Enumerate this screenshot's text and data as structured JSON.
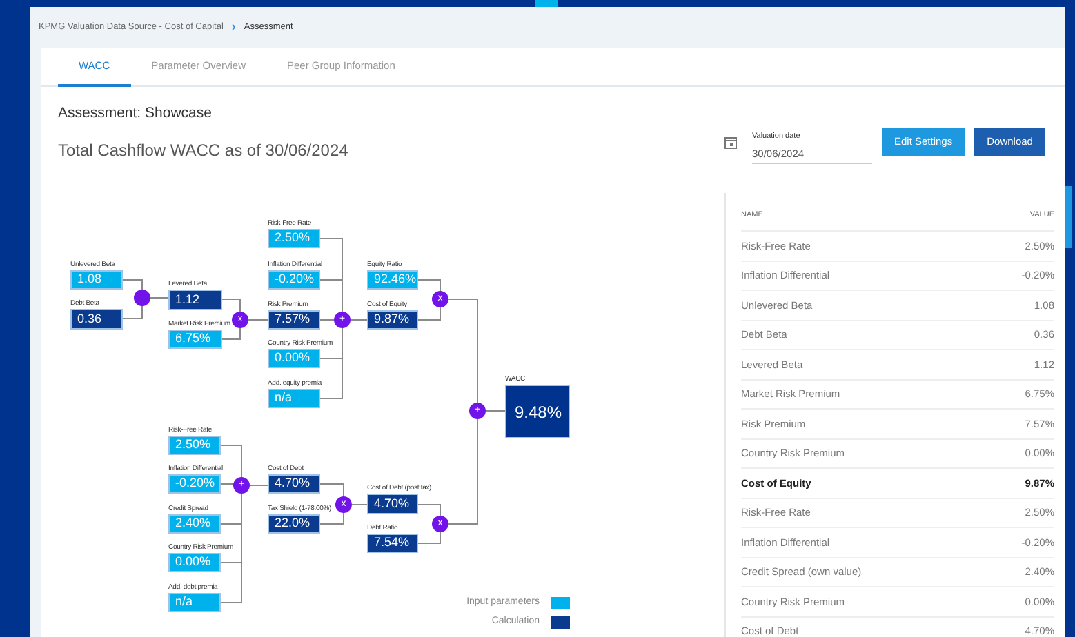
{
  "breadcrumb": {
    "items": [
      "KPMG Valuation Data Source - Cost of Capital",
      "Assessment"
    ],
    "separator": "›"
  },
  "tabs": [
    {
      "label": "WACC",
      "selected": true
    },
    {
      "label": "Parameter Overview",
      "selected": false
    },
    {
      "label": "Peer Group Information",
      "selected": false
    }
  ],
  "heading": "Assessment: Showcase",
  "subtitle": "Total Cashflow WACC as of 30/06/2024",
  "valuation_date": {
    "label": "Valuation date",
    "value": "30/06/2024"
  },
  "buttons": [
    {
      "label": "Edit Settings",
      "kind": "secondary"
    },
    {
      "label": "Download",
      "kind": "primary"
    }
  ],
  "diagram": {
    "nodes": [
      {
        "label": "Unlevered Beta",
        "value": "1.08",
        "kind": "input"
      },
      {
        "label": "Debt Beta",
        "value": "0.36",
        "kind": "calc"
      },
      {
        "label": "Levered Beta",
        "value": "1.12",
        "kind": "calc"
      },
      {
        "label": "Market Risk Premium",
        "value": "6.75%",
        "kind": "input"
      },
      {
        "label": "Risk-Free Rate",
        "value": "2.50%",
        "kind": "input"
      },
      {
        "label": "Inflation Differential",
        "value": "-0.20%",
        "kind": "input"
      },
      {
        "label": "Risk Premium",
        "value": "7.57%",
        "kind": "calc"
      },
      {
        "label": "Country Risk Premium",
        "value": "0.00%",
        "kind": "input"
      },
      {
        "label": "Add. equity premia",
        "value": "n/a",
        "kind": "input"
      },
      {
        "label": "Equity Ratio",
        "value": "92.46%",
        "kind": "input"
      },
      {
        "label": "Cost of Equity",
        "value": "9.87%",
        "kind": "calc"
      },
      {
        "label": "WACC",
        "value": "9.48%",
        "kind": "result"
      },
      {
        "label": "Risk-Free Rate",
        "value": "2.50%",
        "kind": "input"
      },
      {
        "label": "Inflation Differential",
        "value": "-0.20%",
        "kind": "input"
      },
      {
        "label": "Credit Spread",
        "value": "2.40%",
        "kind": "input"
      },
      {
        "label": "Country Risk Premium",
        "value": "0.00%",
        "kind": "input"
      },
      {
        "label": "Add. debt premia",
        "value": "n/a",
        "kind": "input"
      },
      {
        "label": "Cost of Debt",
        "value": "4.70%",
        "kind": "calc"
      },
      {
        "label": "Tax Shield (1-78.00%)",
        "value": "22.0%",
        "kind": "calc"
      },
      {
        "label": "Cost of Debt (post tax)",
        "value": "4.70%",
        "kind": "calc"
      },
      {
        "label": "Debt Ratio",
        "value": "7.54%",
        "kind": "calc"
      }
    ],
    "operators": [
      {
        "kind": "blank"
      },
      {
        "kind": "labeled",
        "symbol": "x"
      },
      {
        "kind": "labeled",
        "symbol": "+"
      },
      {
        "kind": "labeled",
        "symbol": "x"
      },
      {
        "kind": "labeled",
        "symbol": "+"
      },
      {
        "kind": "labeled",
        "symbol": "+"
      },
      {
        "kind": "labeled",
        "symbol": "x"
      },
      {
        "kind": "labeled",
        "symbol": "x"
      }
    ]
  },
  "legend": [
    {
      "label": "Input parameters",
      "kind": "input"
    },
    {
      "label": "Calculation",
      "kind": "calc"
    }
  ],
  "table": {
    "columns": [
      "NAME",
      "VALUE"
    ],
    "rows": [
      {
        "name": "Risk-Free Rate",
        "value": "2.50%",
        "emphasized": false
      },
      {
        "name": "Inflation Differential",
        "value": "-0.20%",
        "emphasized": false
      },
      {
        "name": "Unlevered Beta",
        "value": "1.08",
        "emphasized": false
      },
      {
        "name": "Debt Beta",
        "value": "0.36",
        "emphasized": false
      },
      {
        "name": "Levered Beta",
        "value": "1.12",
        "emphasized": false
      },
      {
        "name": "Market Risk Premium",
        "value": "6.75%",
        "emphasized": false
      },
      {
        "name": "Risk Premium",
        "value": "7.57%",
        "emphasized": false
      },
      {
        "name": "Country Risk Premium",
        "value": "0.00%",
        "emphasized": false
      },
      {
        "name": "Cost of Equity",
        "value": "9.87%",
        "emphasized": true
      },
      {
        "name": "Risk-Free Rate",
        "value": "2.50%",
        "emphasized": false
      },
      {
        "name": "Inflation Differential",
        "value": "-0.20%",
        "emphasized": false
      },
      {
        "name": "Credit Spread (own value)",
        "value": "2.40%",
        "emphasized": false
      },
      {
        "name": "Country Risk Premium",
        "value": "0.00%",
        "emphasized": false
      },
      {
        "name": "Cost of Debt",
        "value": "4.70%",
        "emphasized": false
      }
    ]
  }
}
